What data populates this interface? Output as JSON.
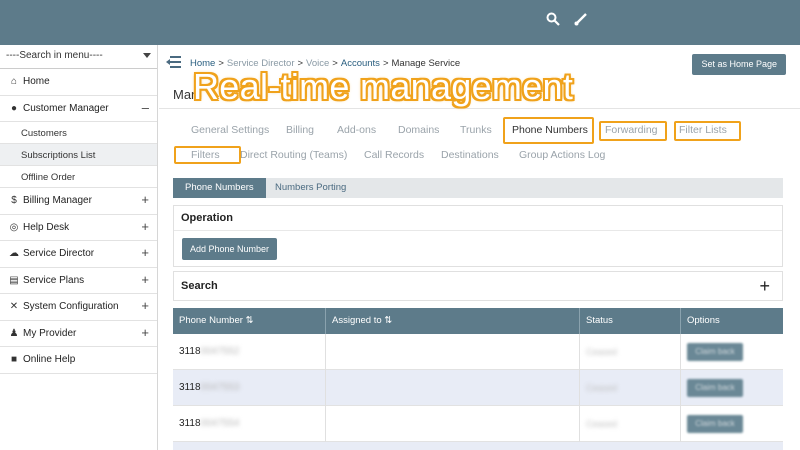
{
  "topbar": {
    "icons": [
      "search-icon",
      "brush-icon"
    ]
  },
  "sidebar": {
    "search_label": "----Search in menu----",
    "items": [
      {
        "label": "Home",
        "icon": "home-icon",
        "sign": ""
      },
      {
        "label": "Customer Manager",
        "icon": "user-icon",
        "sign": "–"
      },
      {
        "label": "Billing Manager",
        "icon": "dollar-icon",
        "sign": "+"
      },
      {
        "label": "Help Desk",
        "icon": "lifebuoy-icon",
        "sign": "+"
      },
      {
        "label": "Service Director",
        "icon": "cloud-icon",
        "sign": "+"
      },
      {
        "label": "Service Plans",
        "icon": "plans-icon",
        "sign": "+"
      },
      {
        "label": "System Configuration",
        "icon": "wrench-icon",
        "sign": "+"
      },
      {
        "label": "My Provider",
        "icon": "provider-icon",
        "sign": "+"
      },
      {
        "label": "Online Help",
        "icon": "box-icon",
        "sign": ""
      }
    ],
    "sub_items": [
      "Customers",
      "Subscriptions List",
      "Offline Order"
    ]
  },
  "breadcrumb": [
    "Home",
    "Service Director",
    "Voice",
    "Accounts",
    "Manage Service"
  ],
  "breadcrumb_sep": ">",
  "home_button": "Set as Home Page",
  "page_title": "Manage Service",
  "overlay_title": "Real-time management",
  "tabs": [
    "General Settings",
    "Billing",
    "Add-ons",
    "Domains",
    "Trunks",
    "Phone Numbers",
    "Forwarding",
    "Filter Lists",
    "Filters",
    "Direct Routing (Teams)",
    "Call Records",
    "Destinations",
    "Group Actions Log"
  ],
  "active_tab": "Phone Numbers",
  "subtabs": [
    "Phone Numbers",
    "Numbers Porting"
  ],
  "operation": {
    "title": "Operation",
    "add_button": "Add Phone Number"
  },
  "search": {
    "title": "Search",
    "toggle": "+"
  },
  "table": {
    "columns": [
      "Phone Number ⇅",
      "Assigned to ⇅",
      "Status",
      "Options"
    ],
    "rows": [
      {
        "prefix": "3118",
        "hidden": "0047552",
        "status": "Ceased",
        "option": "Claim back"
      },
      {
        "prefix": "3118",
        "hidden": "0047553",
        "status": "Ceased",
        "option": "Claim back"
      },
      {
        "prefix": "3118",
        "hidden": "0047554",
        "status": "Ceased",
        "option": "Claim back"
      }
    ]
  },
  "colors": {
    "header": "#5d7b8a",
    "highlight": "#f0a21b",
    "row_alt": "#e8ecf6"
  }
}
